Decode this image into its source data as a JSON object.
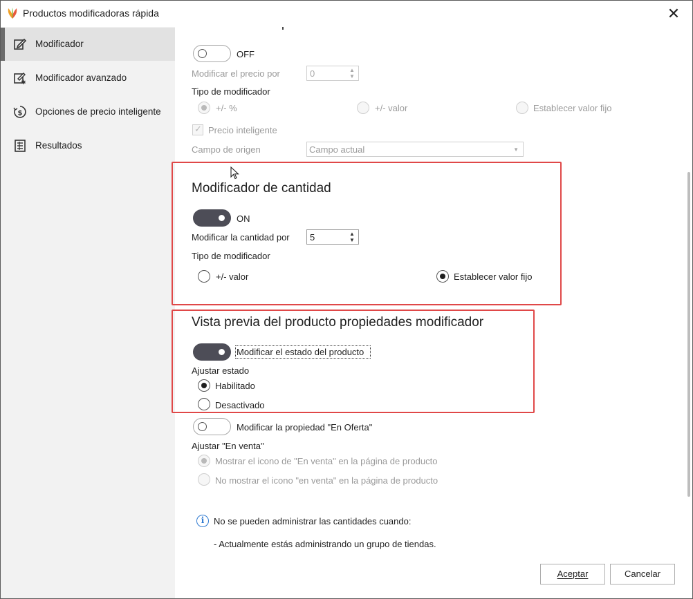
{
  "window": {
    "title": "Productos modificadoras rápida",
    "close_glyph": "✕"
  },
  "sidebar": {
    "items": [
      {
        "label": "Modificador",
        "icon": "edit-icon",
        "active": true
      },
      {
        "label": "Modificador avanzado",
        "icon": "advanced-edit-icon",
        "active": false
      },
      {
        "label": "Opciones de precio inteligente",
        "icon": "smart-price-icon",
        "active": false
      },
      {
        "label": "Resultados",
        "icon": "results-icon",
        "active": false
      }
    ]
  },
  "cost_price": {
    "heading": "Modificador de precio de coste",
    "toggle_state": "OFF",
    "modify_label": "Modificar el precio por",
    "modify_value": "0",
    "type_label": "Tipo de modificador",
    "options": [
      "+/- %",
      "+/- valor",
      "Establecer valor fijo"
    ],
    "selected_option": "+/- %",
    "smart_price_label": "Precio inteligente",
    "smart_price_checked": true,
    "origin_label": "Campo de origen",
    "origin_value": "Campo actual"
  },
  "quantity": {
    "heading": "Modificador de cantidad",
    "toggle_state": "ON",
    "modify_label": "Modificar la cantidad por",
    "modify_value": "5",
    "type_label": "Tipo de modificador",
    "options": [
      "+/- valor",
      "Establecer valor fijo"
    ],
    "selected_option": "Establecer valor fijo"
  },
  "preview": {
    "heading": "Vista previa del producto propiedades modificador",
    "toggle_label": "Modificar el estado del producto",
    "toggle_on": true,
    "adjust_label": "Ajustar estado",
    "options": [
      "Habilitado",
      "Desactivado"
    ],
    "selected_option": "Habilitado"
  },
  "on_sale": {
    "toggle_label": "Modificar la propiedad \"En Oferta\"",
    "toggle_on": false,
    "adjust_label": "Ajustar \"En venta\"",
    "options": [
      "Mostrar el icono de \"En venta\" en la página de producto",
      "No mostrar el icono \"en venta\" en la página de producto"
    ],
    "selected_option": "Mostrar el icono de \"En venta\" en la página de producto"
  },
  "info": {
    "message": "No se pueden administrar las cantidades cuando:",
    "detail": "- Actualmente estás administrando un grupo de tiendas."
  },
  "buttons": {
    "accept": "Aceptar",
    "cancel": "Cancelar"
  },
  "colors": {
    "highlight": "#e04848",
    "toggle_on": "#4d4d57",
    "info": "#2f7ad1"
  }
}
